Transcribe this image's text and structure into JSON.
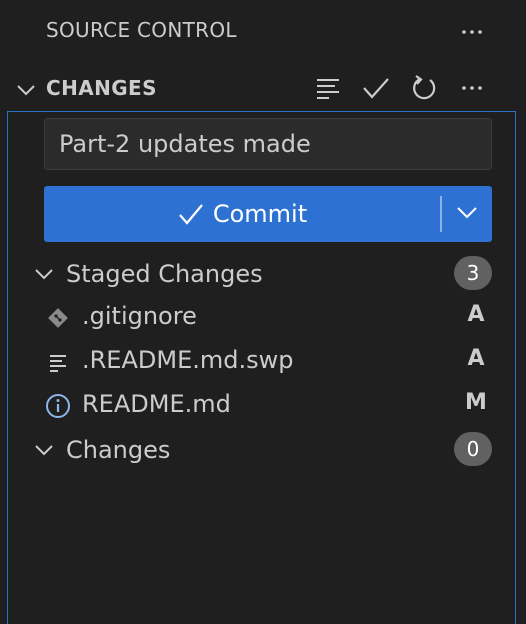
{
  "title_bar": {
    "title": "SOURCE CONTROL",
    "more_icon": "more-horizontal-icon"
  },
  "section": {
    "title": "CHANGES",
    "actions": [
      "view-as-tree-icon",
      "commit-check-icon",
      "refresh-icon",
      "more-horizontal-icon"
    ]
  },
  "commit_message": {
    "value": "Part-2 updates made"
  },
  "commit_button": {
    "label": "Commit",
    "color": "#2d72d2"
  },
  "staged": {
    "label": "Staged Changes",
    "count": "3",
    "files": [
      {
        "name": ".gitignore",
        "status": "A",
        "icon": "git-diamond-icon"
      },
      {
        "name": ".README.md.swp",
        "status": "A",
        "icon": "text-lines-icon"
      },
      {
        "name": "README.md",
        "status": "M",
        "icon": "info-icon"
      }
    ]
  },
  "changes": {
    "label": "Changes",
    "count": "0"
  },
  "colors": {
    "background": "#1f1f20",
    "focus_border": "#2a73c9",
    "badge": "#616161"
  }
}
